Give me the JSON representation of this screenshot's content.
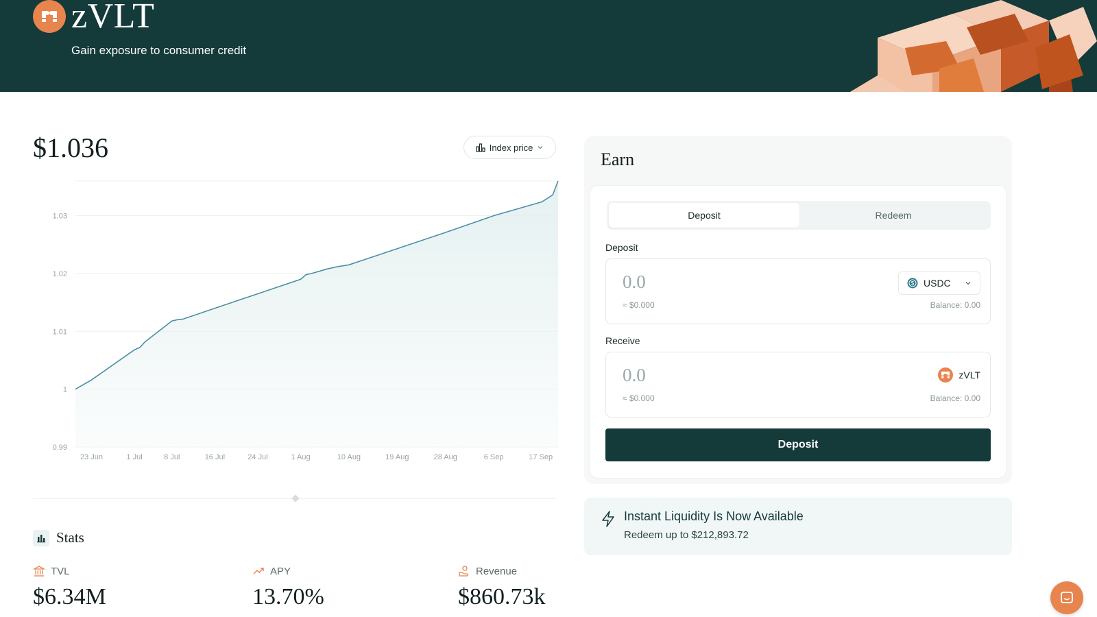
{
  "header": {
    "brand": "zVLT",
    "tagline": "Gain exposure to consumer credit"
  },
  "price": "$1.036",
  "index_selector": {
    "label": "Index price",
    "icon": "bar-chart-icon"
  },
  "chart_data": {
    "type": "area",
    "title": "",
    "xlabel": "",
    "ylabel": "",
    "ylim": [
      0.99,
      1.036
    ],
    "yticks": [
      "0.99",
      "1",
      "1.01",
      "1.02",
      "1.03"
    ],
    "xticks": [
      "23 Jun",
      "1 Jul",
      "8 Jul",
      "16 Jul",
      "24 Jul",
      "1 Aug",
      "10 Aug",
      "19 Aug",
      "28 Aug",
      "6 Sep",
      "17 Sep"
    ],
    "grid": true,
    "series": [
      {
        "x": [
          "20 Jun",
          "23 Jun",
          "1 Jul",
          "2 Jul",
          "3 Jul",
          "8 Jul",
          "9 Jul",
          "10 Jul",
          "16 Jul",
          "24 Jul",
          "1 Aug",
          "2 Aug",
          "3 Aug",
          "6 Aug",
          "7 Aug",
          "8 Aug",
          "10 Aug",
          "19 Aug",
          "28 Aug",
          "6 Sep",
          "15 Sep",
          "16 Sep",
          "17 Sep",
          "18 Sep"
        ],
        "values": [
          1.0,
          1.0016,
          1.0068,
          1.0072,
          1.0082,
          1.0118,
          1.012,
          1.0121,
          1.014,
          1.0165,
          1.019,
          1.0198,
          1.02,
          1.0208,
          1.021,
          1.0212,
          1.0215,
          1.0243,
          1.0271,
          1.03,
          1.0324,
          1.033,
          1.0336,
          1.036
        ]
      }
    ],
    "colors": {
      "line": "#4a8fa6",
      "fill": "#e3efef"
    }
  },
  "stats": {
    "title": "Stats",
    "icon": "stats-chart-icon",
    "items": [
      {
        "label": "TVL",
        "value": "$6.34M",
        "icon": "bank-icon"
      },
      {
        "label": "APY",
        "value": "13.70%",
        "icon": "trending-up-icon"
      },
      {
        "label": "Revenue",
        "value": "$860.73k",
        "icon": "coin-hand-icon"
      }
    ]
  },
  "earn": {
    "title": "Earn",
    "tabs": [
      "Deposit",
      "Redeem"
    ],
    "active_tab": "Deposit",
    "deposit": {
      "label": "Deposit",
      "value": "0.0",
      "usd": "≈ $0.000",
      "token": "USDC",
      "balance": "Balance: 0.00"
    },
    "receive": {
      "label": "Receive",
      "value": "0.0",
      "usd": "≈ $0.000",
      "token": "zVLT",
      "balance": "Balance: 0.00"
    },
    "button": "Deposit"
  },
  "liquidity": {
    "title": "Instant Liquidity Is Now Available",
    "subtitle": "Redeem up to $212,893.72",
    "icon": "lightning-icon"
  },
  "colors": {
    "header_bg": "#143a3a",
    "accent": "#e8844e",
    "button_bg": "#143a3a",
    "chart_line": "#4a8fa6"
  }
}
